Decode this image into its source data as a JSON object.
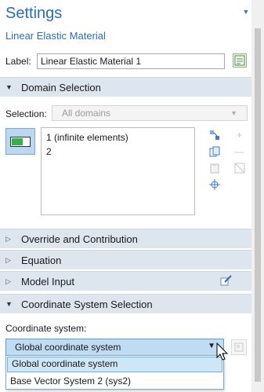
{
  "header": {
    "title": "Settings",
    "subtitle": "Linear Elastic Material"
  },
  "label_field": {
    "caption": "Label:",
    "value": "Linear Elastic Material 1"
  },
  "sections": {
    "domain_selection": "Domain Selection",
    "override": "Override and Contribution",
    "equation": "Equation",
    "model_input": "Model Input",
    "coordinate_system": "Coordinate System Selection"
  },
  "selection": {
    "caption": "Selection:",
    "value": "All domains",
    "items": [
      "1 (infinite elements)",
      "2"
    ]
  },
  "coordinate_system": {
    "caption": "Coordinate system:",
    "selected": "Global coordinate system",
    "options": [
      "Global coordinate system",
      "Base Vector System 2 (sys2)"
    ]
  },
  "colors": {
    "accent": "#2a6fb0",
    "section_bg": "#dde5ef",
    "selected_bg": "#bfdcf4",
    "toggle_on": "#2fb34a"
  }
}
